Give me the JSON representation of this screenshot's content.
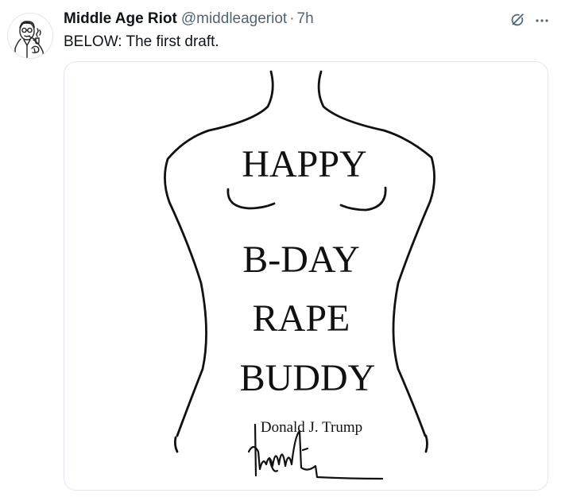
{
  "tweet": {
    "display_name": "Middle Age Riot",
    "handle": "@middleageriot",
    "separator": "·",
    "time": "7h",
    "text": "BELOW: The first draft."
  },
  "icons": {
    "avatar": "vintage-man-with-pipe-avatar",
    "grok": "grok-icon",
    "more": "more-options-icon"
  },
  "media": {
    "lines": [
      "HAPPY",
      "B-DAY",
      "RAPE",
      "BUDDY"
    ],
    "signature_name": "Donald J. Trump",
    "signature": "Donald Trump handwritten signature"
  },
  "colors": {
    "text_primary": "#0f1419",
    "text_secondary": "#536471",
    "border": "#e1e8ed",
    "ink": "#111111"
  }
}
